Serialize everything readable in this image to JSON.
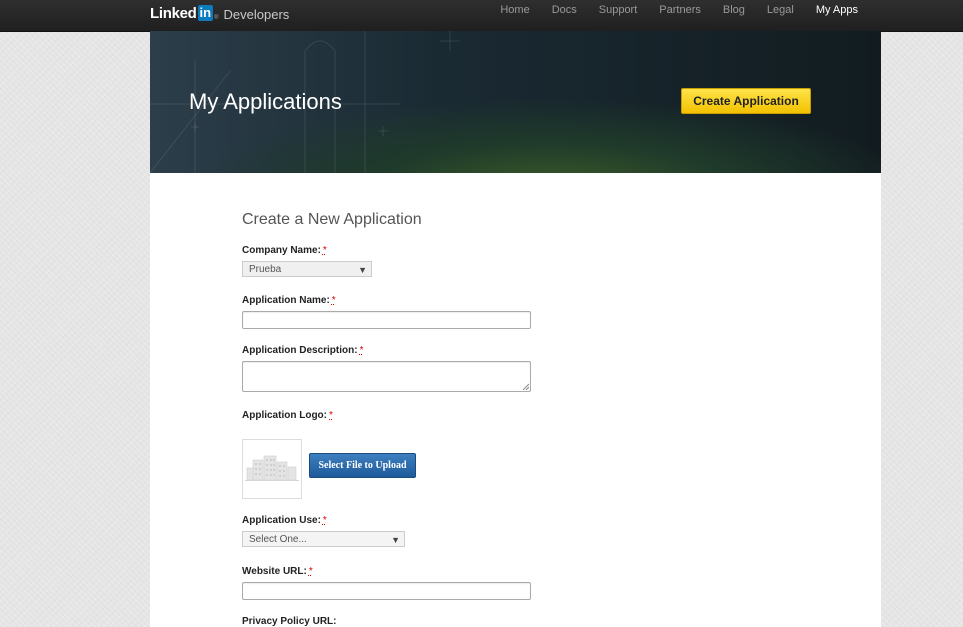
{
  "header": {
    "brand_linked": "Linked",
    "brand_in": "in",
    "brand_reg": "®",
    "brand_product": "Developers",
    "nav": [
      {
        "label": "Home",
        "active": false
      },
      {
        "label": "Docs",
        "active": false
      },
      {
        "label": "Support",
        "active": false
      },
      {
        "label": "Partners",
        "active": false
      },
      {
        "label": "Blog",
        "active": false
      },
      {
        "label": "Legal",
        "active": false
      },
      {
        "label": "My Apps",
        "active": true
      }
    ]
  },
  "hero": {
    "title": "My Applications",
    "create_button": "Create Application"
  },
  "form": {
    "title": "Create a New Application",
    "required_marker": "*",
    "company_name": {
      "label": "Company Name:",
      "value": "Prueba"
    },
    "application_name": {
      "label": "Application Name:",
      "value": ""
    },
    "application_description": {
      "label": "Application Description:",
      "value": ""
    },
    "application_logo": {
      "label": "Application Logo:",
      "upload_button": "Select File to Upload"
    },
    "application_use": {
      "label": "Application Use:",
      "value": "Select One..."
    },
    "website_url": {
      "label": "Website URL:",
      "value": ""
    },
    "privacy_policy_url": {
      "label": "Privacy Policy URL:"
    }
  },
  "colors": {
    "topbar": "#262626",
    "accent_yellow": "#f5c800",
    "upload_blue": "#2a6aab",
    "required_red": "#dd0000"
  },
  "icons": {
    "select_arrow": "▼",
    "logo_placeholder": "building-icon"
  }
}
